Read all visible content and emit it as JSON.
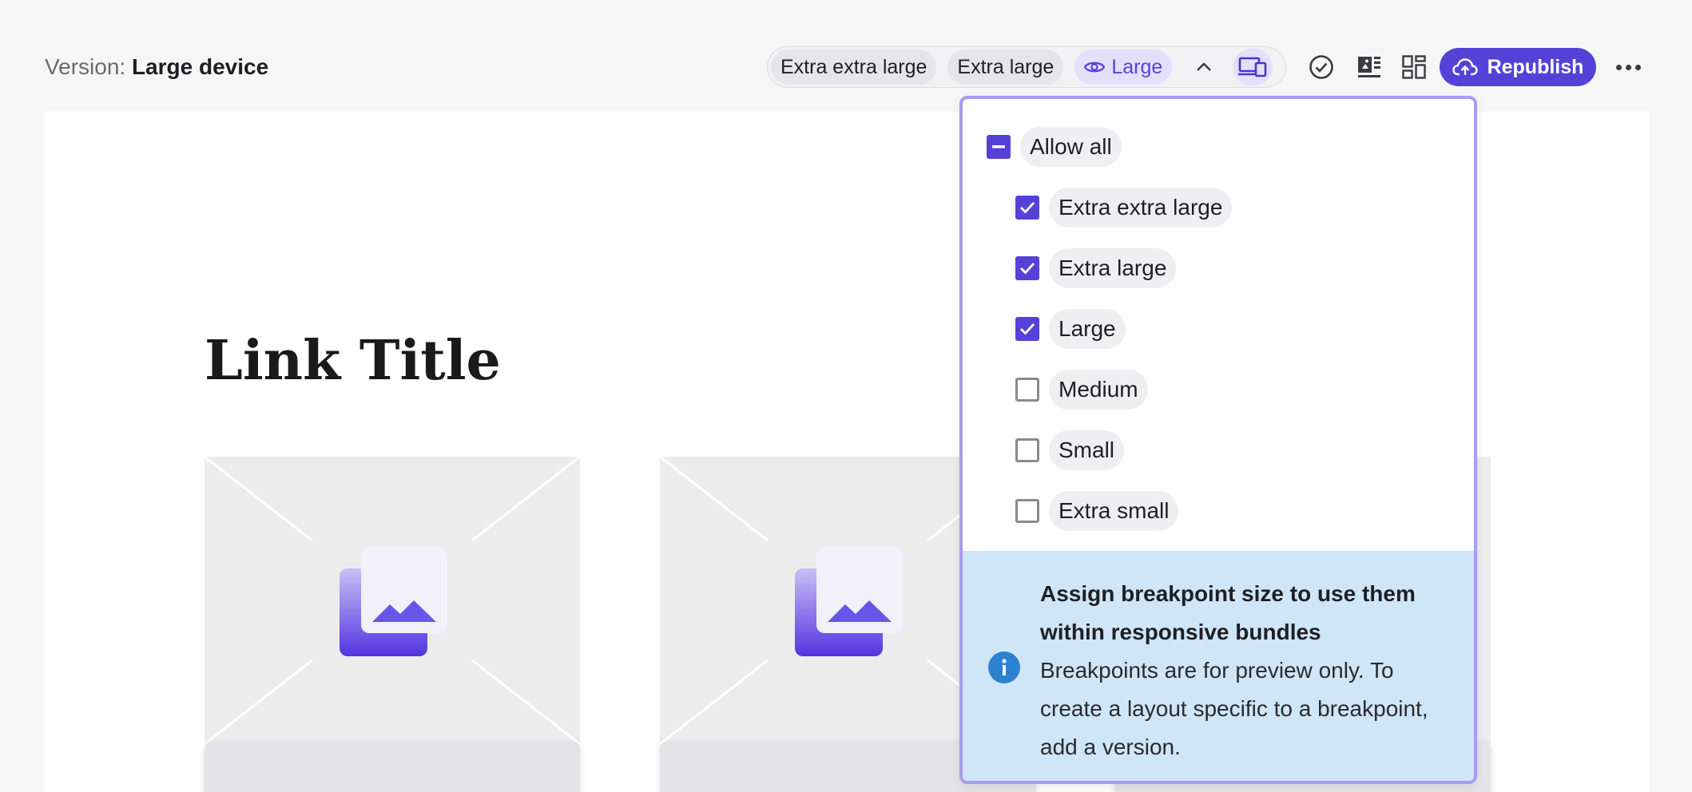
{
  "header": {
    "version_label": "Version:",
    "version_value": "Large device",
    "breakpoints": [
      {
        "label": "Extra extra large",
        "active": false
      },
      {
        "label": "Extra large",
        "active": false
      },
      {
        "label": "Large",
        "active": true
      }
    ],
    "republish_label": "Republish",
    "icons": [
      "chevron-up-icon",
      "devices-icon",
      "check-circle-icon",
      "layout-icon",
      "grid-icon",
      "cloud-upload-icon",
      "more-icon"
    ]
  },
  "canvas": {
    "title": "Link Title"
  },
  "dropdown": {
    "allow_all_label": "Allow all",
    "options": [
      {
        "label": "Extra extra large",
        "checked": true
      },
      {
        "label": "Extra large",
        "checked": true
      },
      {
        "label": "Large",
        "checked": true
      },
      {
        "label": "Medium",
        "checked": false
      },
      {
        "label": "Small",
        "checked": false
      },
      {
        "label": "Extra small",
        "checked": false
      }
    ],
    "info_title": "Assign breakpoint size to use them within responsive bundles",
    "info_body": "Breakpoints are for preview only. To create a layout specific to a breakpoint, add a version."
  },
  "colors": {
    "accent": "#5541d8",
    "accent_light": "#e4e0fb",
    "info_bg": "#cfe6f8",
    "info_icon": "#2d82d0"
  }
}
